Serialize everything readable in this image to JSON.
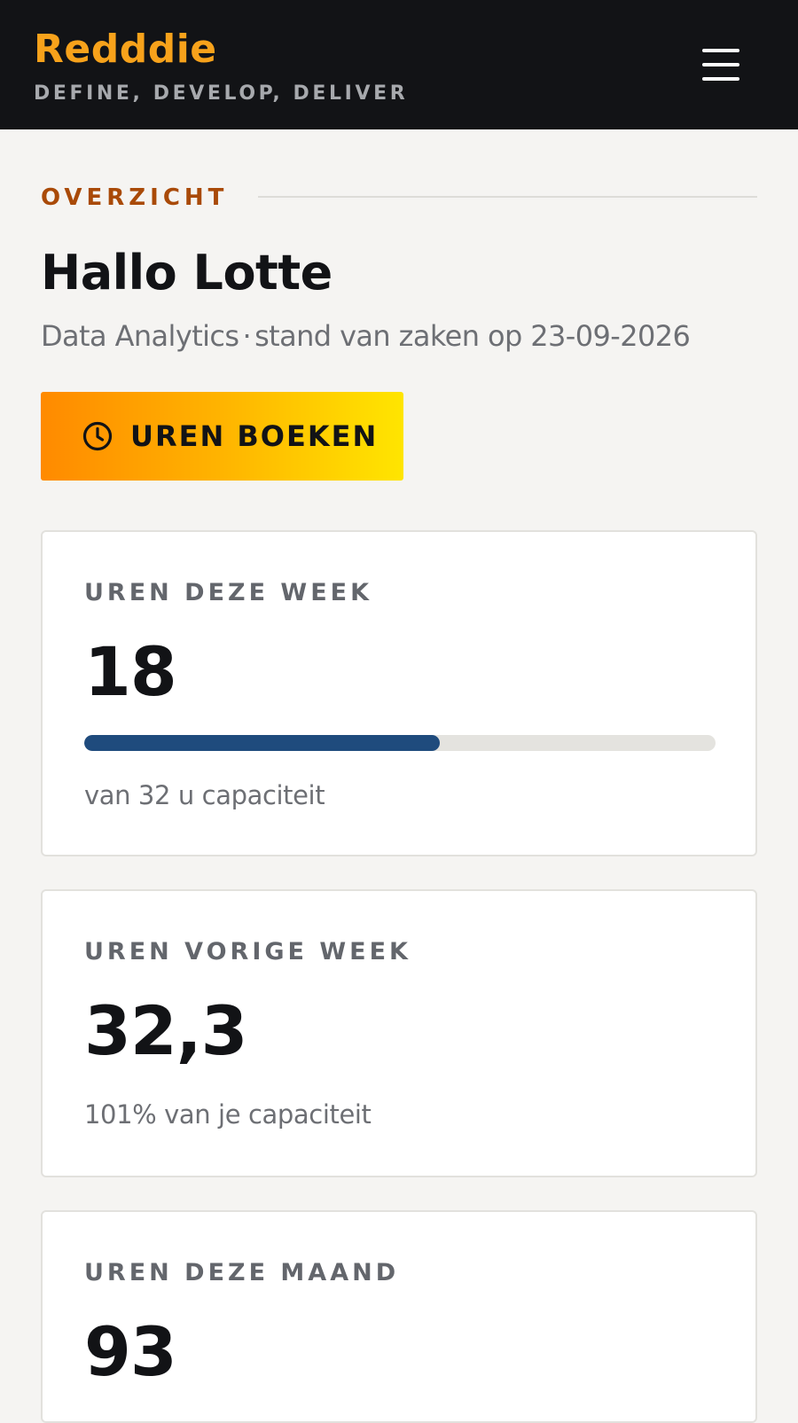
{
  "header": {
    "brand": "Redddie",
    "tagline": "DEFINE, DEVELOP, DELIVER",
    "menu_icon": "hamburger-menu-icon"
  },
  "overview": {
    "section_label": "OVERZICHT",
    "greeting": "Hallo Lotte",
    "department": "Data Analytics",
    "separator": "·",
    "status_text": "stand van zaken op 23-09-2026"
  },
  "book_button": {
    "icon": "clock-icon",
    "label": "UREN BOEKEN"
  },
  "cards": [
    {
      "label": "UREN DEZE WEEK",
      "value": "18",
      "progress": 0.5625,
      "note": "van 32 u capaciteit"
    },
    {
      "label": "UREN VORIGE WEEK",
      "value": "32,3",
      "note": "101% van je capaciteit"
    },
    {
      "label": "UREN DEZE MAAND",
      "value": "93"
    }
  ],
  "colors": {
    "brand": "#f7a21b",
    "header_bg": "#121316",
    "section_accent": "#a94a08",
    "progress": "#1f4b7d"
  }
}
